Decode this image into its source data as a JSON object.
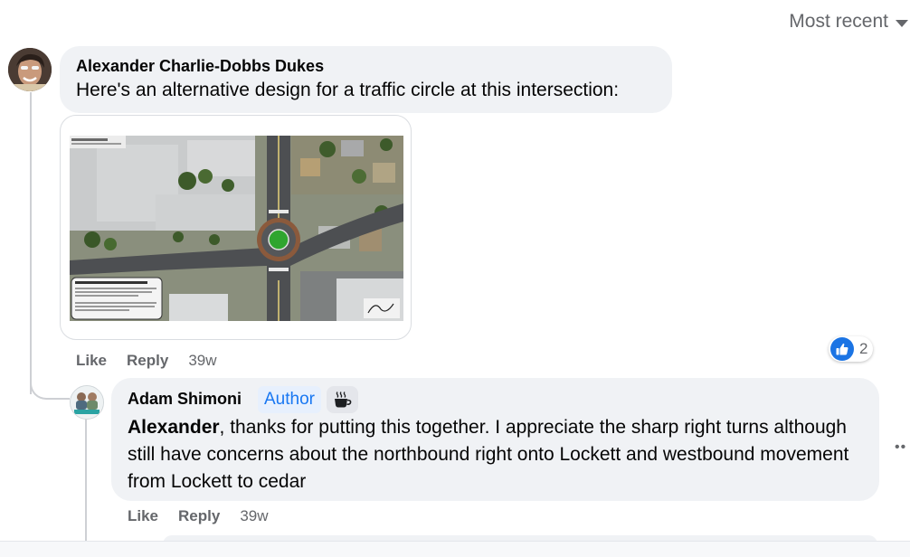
{
  "sort": {
    "label": "Most recent"
  },
  "comments": [
    {
      "author": "Alexander Charlie-Dobbs Dukes",
      "text": "Here's an alternative design for a traffic circle at this intersection:",
      "actions": {
        "like": "Like",
        "reply": "Reply",
        "time": "39w"
      },
      "reactions": {
        "icon": "like-icon",
        "count": "2"
      }
    },
    {
      "author": "Adam Shimoni",
      "badge": "Author",
      "badge_icon": "coffee-icon",
      "text_mention": "Alexander",
      "text_rest": ", thanks for putting this together. I appreciate the sharp right turns although still have concerns about the northbound right onto Lockett and westbound movement from Lockett to cedar",
      "actions": {
        "like": "Like",
        "reply": "Reply",
        "time": "39w"
      }
    }
  ],
  "attachment": {
    "title": "Flagstaff, AZ Traffic Circle Proposal",
    "note_heading": "Note: This design is for visioning purposes only"
  },
  "colors": {
    "accent": "#1877f2",
    "bubble": "#f0f2f5",
    "muted": "#65676b"
  }
}
